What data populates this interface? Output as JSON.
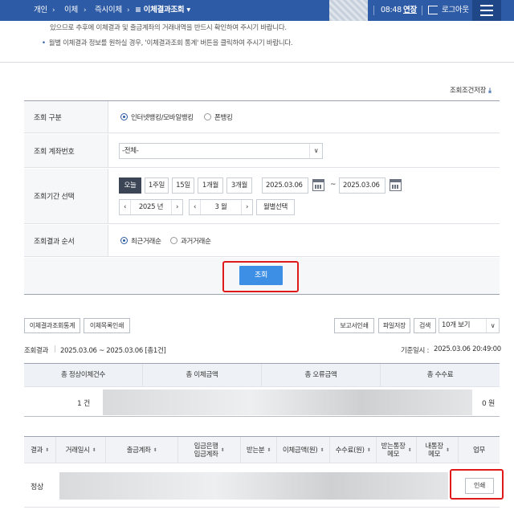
{
  "nav": {
    "crumb1": "개인",
    "crumb2": "이체",
    "crumb3": "즉시이체",
    "crumb4": "이체결과조회",
    "timer": "08:48",
    "extend": "연장",
    "logout": "로그아웃"
  },
  "notice": {
    "line1": "있으므로 추후에 이체결과 및 출금계좌의 거래내역을 반드시 확인하여 주시기 바랍니다.",
    "line2": "월별 이체결과 정보를 원하실 경우, '이체결과조회 통계' 버튼을 클릭하여 주시기 바랍니다."
  },
  "save_condition": "조회조건저장",
  "search": {
    "type_label": "조회 구분",
    "type_opt1": "인터넷뱅킹/모바일뱅킹",
    "type_opt2": "폰뱅킹",
    "account_label": "조회 계좌번호",
    "account_value": "-전체-",
    "period_label": "조회기간 선택",
    "period_buttons": [
      "오늘",
      "1주일",
      "15일",
      "1개월",
      "3개월"
    ],
    "date_from": "2025.03.06",
    "date_tilde": "~",
    "date_to": "2025.03.06",
    "year": "2025 년",
    "month": "3 월",
    "month_select": "월별선택",
    "order_label": "조회결과 순서",
    "order_opt1": "최근거래순",
    "order_opt2": "과거거래순",
    "query_button": "조회"
  },
  "toolbar": {
    "stats": "이체결과조회통계",
    "print_list": "이체목록인쇄",
    "report_print": "보고서인쇄",
    "file_save": "파일저장",
    "search": "검색",
    "page_size": "10개 보기"
  },
  "result": {
    "label": "조회결과",
    "range": "2025.03.06 ~ 2025.03.06 [총1건]",
    "base_label": "기준일시 :",
    "base_time": "2025.03.06 20:49:00"
  },
  "summary": {
    "headers": [
      "총 정상이체건수",
      "총 이체금액",
      "총 오류금액",
      "총 수수료"
    ],
    "count": "1 건",
    "fee": "0 원"
  },
  "detail": {
    "headers": [
      "결과",
      "거래일시",
      "출금계좌",
      "입금은행\n입금계좌",
      "받는분",
      "이체금액(원)",
      "수수료(원)",
      "받는통장\n메모",
      "내통장\n메모",
      "업무"
    ],
    "row_status": "정상",
    "print_button": "인쇄"
  },
  "colors": {
    "nav_bg": "#2e5ba5",
    "query_button": "#3d8fe5",
    "highlight_box": "#e01a1a"
  }
}
